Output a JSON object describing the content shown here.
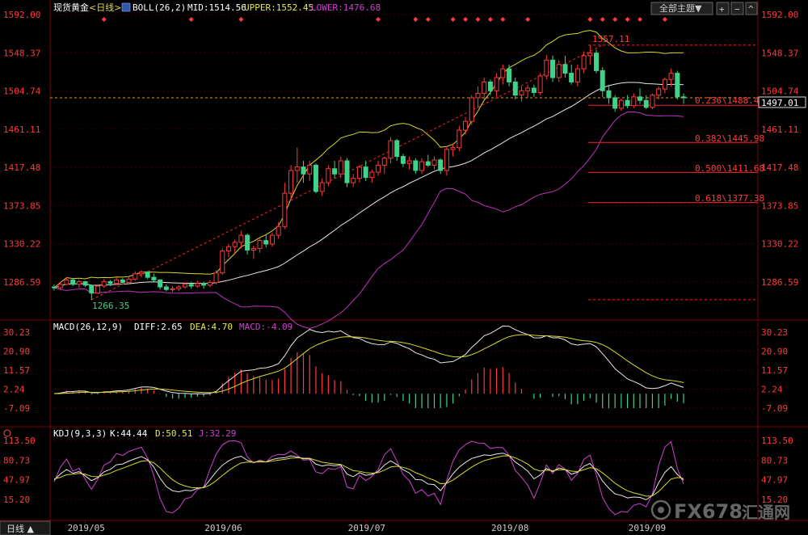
{
  "header": {
    "instrument": "现货黄金",
    "period": "<日线>",
    "indicator": "BOLL(26,2)",
    "mid": "MID:1514.56",
    "upper": "UPPER:1552.45",
    "lower": "LOWER:1476.68",
    "theme_button": "全部主题▼"
  },
  "macd_header": {
    "name": "MACD(26,12,9)",
    "diff": "DIFF:2.65",
    "dea": "DEA:4.70",
    "macd": "MACD:-4.09"
  },
  "kdj_header": {
    "name": "KDJ(9,3,3)",
    "k": "K:44.44",
    "d": "D:50.51",
    "j": "J:32.29"
  },
  "footer": {
    "period_tab": "日线 ▲",
    "months": [
      "2019/05",
      "2019/06",
      "2019/07",
      "2019/08",
      "2019/09"
    ]
  },
  "watermark": {
    "text": "FX678",
    "cjk": "汇通网"
  },
  "colors": {
    "up": "#ff3a3a",
    "down": "#3fd28a",
    "mid": "#e8e8e8",
    "upper": "#d8d82a",
    "lower": "#c030c0",
    "fib": "#ff2020",
    "k": "#e8e8e8",
    "d": "#d8d82a",
    "j": "#d040d0"
  },
  "chart_data": [
    {
      "type": "candlestick",
      "title": "现货黄金<日线>",
      "ylim": [
        1266,
        1592
      ],
      "y_ticks": [
        "1592.00",
        "1548.37",
        "1504.74",
        "1461.11",
        "1417.48",
        "1373.85",
        "1330.22",
        "1286.59"
      ],
      "current_price": "1497.01",
      "high_label": "1557.11",
      "low_label": "1266.35",
      "fib_levels": [
        {
          "label": "0.236\\1488.42",
          "value": 1488.42
        },
        {
          "label": "0.382\\1445.98",
          "value": 1445.98
        },
        {
          "label": "0.500\\1411.68",
          "value": 1411.68
        },
        {
          "label": "0.618\\1377.38",
          "value": 1377.38
        }
      ],
      "fib_top": 1557.11,
      "fib_bottom": 1266.35,
      "ohlc": [
        [
          1281,
          1284,
          1277,
          1280
        ],
        [
          1280,
          1286,
          1278,
          1284
        ],
        [
          1284,
          1292,
          1283,
          1289
        ],
        [
          1289,
          1291,
          1282,
          1284
        ],
        [
          1284,
          1289,
          1280,
          1287
        ],
        [
          1287,
          1288,
          1281,
          1283
        ],
        [
          1283,
          1284,
          1266,
          1274
        ],
        [
          1274,
          1284,
          1273,
          1282
        ],
        [
          1282,
          1290,
          1280,
          1287
        ],
        [
          1287,
          1289,
          1282,
          1285
        ],
        [
          1285,
          1292,
          1283,
          1289
        ],
        [
          1289,
          1291,
          1285,
          1286
        ],
        [
          1286,
          1293,
          1284,
          1290
        ],
        [
          1290,
          1299,
          1288,
          1296
        ],
        [
          1296,
          1300,
          1292,
          1298
        ],
        [
          1298,
          1299,
          1290,
          1292
        ],
        [
          1292,
          1296,
          1287,
          1289
        ],
        [
          1289,
          1290,
          1278,
          1281
        ],
        [
          1281,
          1284,
          1276,
          1278
        ],
        [
          1278,
          1282,
          1275,
          1279
        ],
        [
          1279,
          1283,
          1276,
          1281
        ],
        [
          1281,
          1286,
          1279,
          1284
        ],
        [
          1284,
          1287,
          1279,
          1282
        ],
        [
          1282,
          1288,
          1280,
          1285
        ],
        [
          1285,
          1287,
          1279,
          1283
        ],
        [
          1283,
          1289,
          1281,
          1286
        ],
        [
          1286,
          1300,
          1284,
          1297
        ],
        [
          1297,
          1325,
          1295,
          1322
        ],
        [
          1322,
          1330,
          1315,
          1327
        ],
        [
          1327,
          1335,
          1318,
          1332
        ],
        [
          1332,
          1345,
          1325,
          1340
        ],
        [
          1340,
          1342,
          1318,
          1323
        ],
        [
          1323,
          1328,
          1313,
          1325
        ],
        [
          1325,
          1338,
          1320,
          1334
        ],
        [
          1334,
          1340,
          1326,
          1330
        ],
        [
          1330,
          1343,
          1327,
          1340
        ],
        [
          1340,
          1355,
          1336,
          1350
        ],
        [
          1350,
          1400,
          1347,
          1388
        ],
        [
          1388,
          1420,
          1380,
          1414
        ],
        [
          1414,
          1440,
          1400,
          1418
        ],
        [
          1418,
          1425,
          1400,
          1410
        ],
        [
          1410,
          1425,
          1402,
          1420
        ],
        [
          1420,
          1422,
          1388,
          1390
        ],
        [
          1390,
          1405,
          1385,
          1400
        ],
        [
          1400,
          1420,
          1396,
          1416
        ],
        [
          1416,
          1425,
          1405,
          1410
        ],
        [
          1410,
          1430,
          1405,
          1425
        ],
        [
          1425,
          1428,
          1395,
          1400
        ],
        [
          1400,
          1410,
          1395,
          1405
        ],
        [
          1405,
          1420,
          1400,
          1418
        ],
        [
          1418,
          1425,
          1402,
          1406
        ],
        [
          1406,
          1415,
          1400,
          1412
        ],
        [
          1412,
          1425,
          1408,
          1420
        ],
        [
          1420,
          1430,
          1410,
          1428
        ],
        [
          1428,
          1452,
          1422,
          1448
        ],
        [
          1448,
          1450,
          1425,
          1430
        ],
        [
          1430,
          1433,
          1418,
          1422
        ],
        [
          1422,
          1430,
          1415,
          1425
        ],
        [
          1425,
          1428,
          1410,
          1414
        ],
        [
          1414,
          1428,
          1410,
          1424
        ],
        [
          1424,
          1432,
          1418,
          1420
        ],
        [
          1420,
          1430,
          1415,
          1426
        ],
        [
          1426,
          1428,
          1410,
          1414
        ],
        [
          1414,
          1442,
          1408,
          1438
        ],
        [
          1438,
          1445,
          1430,
          1440
        ],
        [
          1440,
          1465,
          1436,
          1460
        ],
        [
          1460,
          1475,
          1455,
          1470
        ],
        [
          1470,
          1500,
          1466,
          1497
        ],
        [
          1497,
          1510,
          1485,
          1502
        ],
        [
          1502,
          1520,
          1495,
          1515
        ],
        [
          1515,
          1518,
          1500,
          1505
        ],
        [
          1505,
          1525,
          1498,
          1520
        ],
        [
          1520,
          1535,
          1512,
          1530
        ],
        [
          1530,
          1535,
          1510,
          1515
        ],
        [
          1515,
          1520,
          1495,
          1500
        ],
        [
          1500,
          1510,
          1493,
          1505
        ],
        [
          1505,
          1512,
          1497,
          1508
        ],
        [
          1508,
          1512,
          1498,
          1503
        ],
        [
          1503,
          1525,
          1500,
          1522
        ],
        [
          1522,
          1546,
          1518,
          1540
        ],
        [
          1540,
          1545,
          1515,
          1520
        ],
        [
          1520,
          1540,
          1515,
          1535
        ],
        [
          1535,
          1545,
          1520,
          1525
        ],
        [
          1525,
          1535,
          1512,
          1515
        ],
        [
          1515,
          1535,
          1510,
          1530
        ],
        [
          1530,
          1550,
          1525,
          1545
        ],
        [
          1545,
          1557,
          1535,
          1548
        ],
        [
          1548,
          1552,
          1525,
          1528
        ],
        [
          1528,
          1532,
          1498,
          1505
        ],
        [
          1505,
          1512,
          1490,
          1497
        ],
        [
          1497,
          1500,
          1481,
          1485
        ],
        [
          1485,
          1496,
          1482,
          1494
        ],
        [
          1494,
          1500,
          1485,
          1488
        ],
        [
          1488,
          1502,
          1485,
          1498
        ],
        [
          1498,
          1508,
          1490,
          1494
        ],
        [
          1494,
          1500,
          1484,
          1486
        ],
        [
          1486,
          1502,
          1484,
          1500
        ],
        [
          1500,
          1510,
          1495,
          1507
        ],
        [
          1507,
          1520,
          1502,
          1518
        ],
        [
          1518,
          1530,
          1510,
          1525
        ],
        [
          1525,
          1528,
          1495,
          1498
        ],
        [
          1498,
          1502,
          1490,
          1497
        ]
      ]
    },
    {
      "type": "bar",
      "title": "MACD(26,12,9)",
      "ylim": [
        -7.09,
        30.23
      ],
      "y_ticks": [
        "30.23",
        "20.90",
        "11.57",
        "2.24",
        "-7.09"
      ]
    },
    {
      "type": "line",
      "title": "KDJ(9,3,3)",
      "ylim": [
        15.2,
        113.5
      ],
      "y_ticks": [
        "113.50",
        "80.73",
        "47.97",
        "15.20"
      ]
    }
  ]
}
